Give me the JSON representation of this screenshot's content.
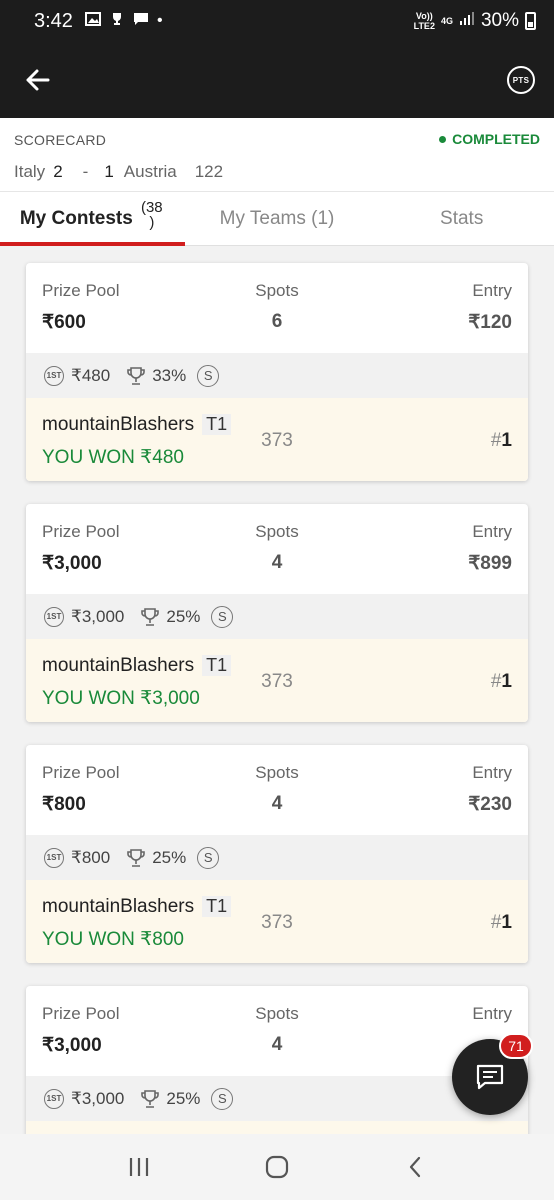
{
  "status_bar": {
    "time": "3:42",
    "network_top": "Vo))",
    "network_bottom": "LTE2",
    "network_type": "4G",
    "battery": "30%"
  },
  "header": {
    "back_icon": "arrow-left-icon",
    "pts_label": "PTS"
  },
  "scorecard": {
    "label": "SCORECARD",
    "status": "COMPLETED",
    "status_color": "#1a8a3a",
    "team1": "Italy",
    "score1": "2",
    "separator": "-",
    "score2": "1",
    "team2": "Austria",
    "minute": "122"
  },
  "tabs": [
    {
      "label": "My Contests",
      "count_line1": "(38",
      "count_line2": ")"
    },
    {
      "label": "My Teams (1)"
    },
    {
      "label": "Stats"
    }
  ],
  "labels": {
    "prize_pool": "Prize Pool",
    "spots": "Spots",
    "entry": "Entry",
    "rank_hash": "#"
  },
  "contests": [
    {
      "prize_pool": "₹600",
      "spots": "6",
      "entry": "₹120",
      "first_prize": "₹480",
      "winners_pct": "33%",
      "team": "mountainBlashers",
      "team_tag": "T1",
      "result": "YOU WON ₹480",
      "points": "373",
      "rank": "1"
    },
    {
      "prize_pool": "₹3,000",
      "spots": "4",
      "entry": "₹899",
      "first_prize": "₹3,000",
      "winners_pct": "25%",
      "team": "mountainBlashers",
      "team_tag": "T1",
      "result": "YOU WON ₹3,000",
      "points": "373",
      "rank": "1"
    },
    {
      "prize_pool": "₹800",
      "spots": "4",
      "entry": "₹230",
      "first_prize": "₹800",
      "winners_pct": "25%",
      "team": "mountainBlashers",
      "team_tag": "T1",
      "result": "YOU WON ₹800",
      "points": "373",
      "rank": "1"
    },
    {
      "prize_pool": "₹3,000",
      "spots": "4",
      "entry": "",
      "first_prize": "₹3,000",
      "winners_pct": "25%",
      "team": "",
      "team_tag": "",
      "result": "",
      "points": "",
      "rank": ""
    }
  ],
  "badges": {
    "first_icon_text": "1ST",
    "single_entry_text": "S"
  },
  "chat": {
    "badge_count": "71"
  },
  "colors": {
    "accent_red": "#d11e1e",
    "win_green": "#1a8a3a",
    "header_bg": "#1c1c1c"
  }
}
